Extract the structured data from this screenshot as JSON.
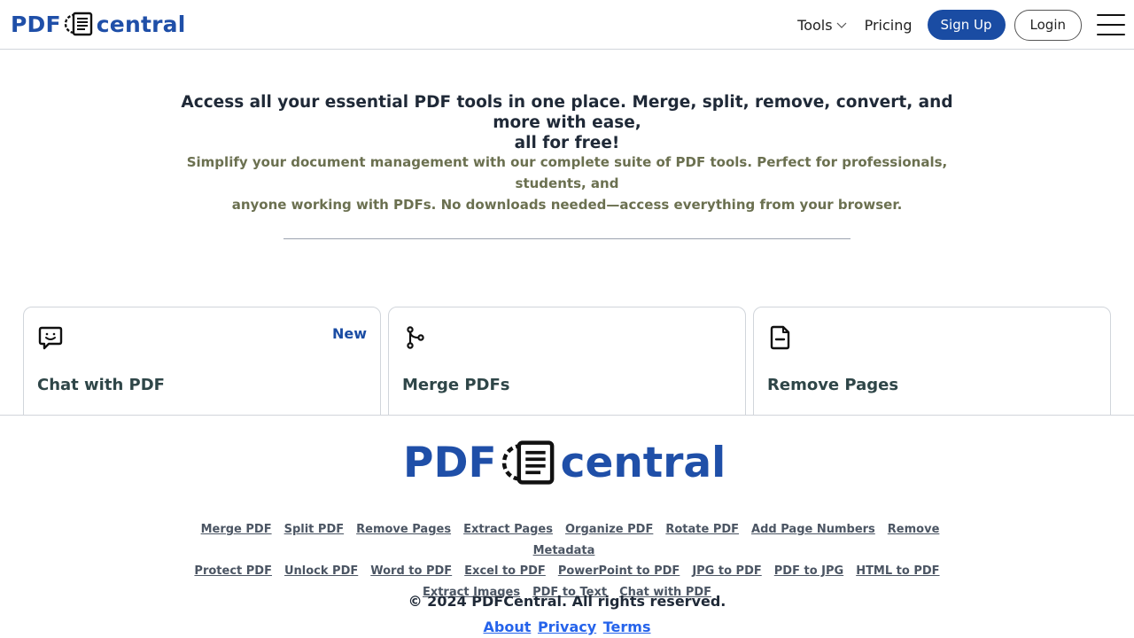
{
  "header": {
    "logo_left": "PDF",
    "logo_right": "central",
    "nav_tools": "Tools",
    "nav_pricing": "Pricing",
    "signup_label": "Sign Up",
    "login_label": "Login"
  },
  "hero": {
    "title_line1": "Access all your essential PDF tools in one place. Merge, split, remove, convert, and more with ease,",
    "title_line2": "all for free!",
    "subtitle_line1": "Simplify your document management with our complete suite of PDF tools. Perfect for professionals, students, and",
    "subtitle_line2": "anyone working with PDFs. No downloads needed—access everything from your browser."
  },
  "cards": [
    {
      "title": "Chat with PDF",
      "badge": "New",
      "icon": "chat-bubble-icon"
    },
    {
      "title": "Merge PDFs",
      "badge": "",
      "icon": "git-merge-icon"
    },
    {
      "title": "Remove Pages",
      "badge": "",
      "icon": "file-minus-icon"
    }
  ],
  "footer": {
    "logo_left": "PDF",
    "logo_right": "central",
    "links_row1": [
      "Merge PDF",
      "Split PDF",
      "Remove Pages",
      "Extract Pages",
      "Organize PDF",
      "Rotate PDF",
      "Add Page Numbers",
      "Remove Metadata"
    ],
    "links_row2": [
      "Protect PDF",
      "Unlock PDF",
      "Word to PDF",
      "Excel to PDF",
      "PowerPoint to PDF",
      "JPG to PDF",
      "PDF to JPG",
      "HTML to PDF"
    ],
    "links_row3": [
      "Extract Images",
      "PDF to Text",
      "Chat with PDF"
    ],
    "copyright": "© 2024 PDFCentral. All rights reserved.",
    "legal": [
      "About",
      "Privacy",
      "Terms"
    ]
  },
  "colors": {
    "brand": "#1f4fa8",
    "button": "#1a4ca3",
    "subtitle": "#6b7050",
    "link": "#2563eb"
  }
}
